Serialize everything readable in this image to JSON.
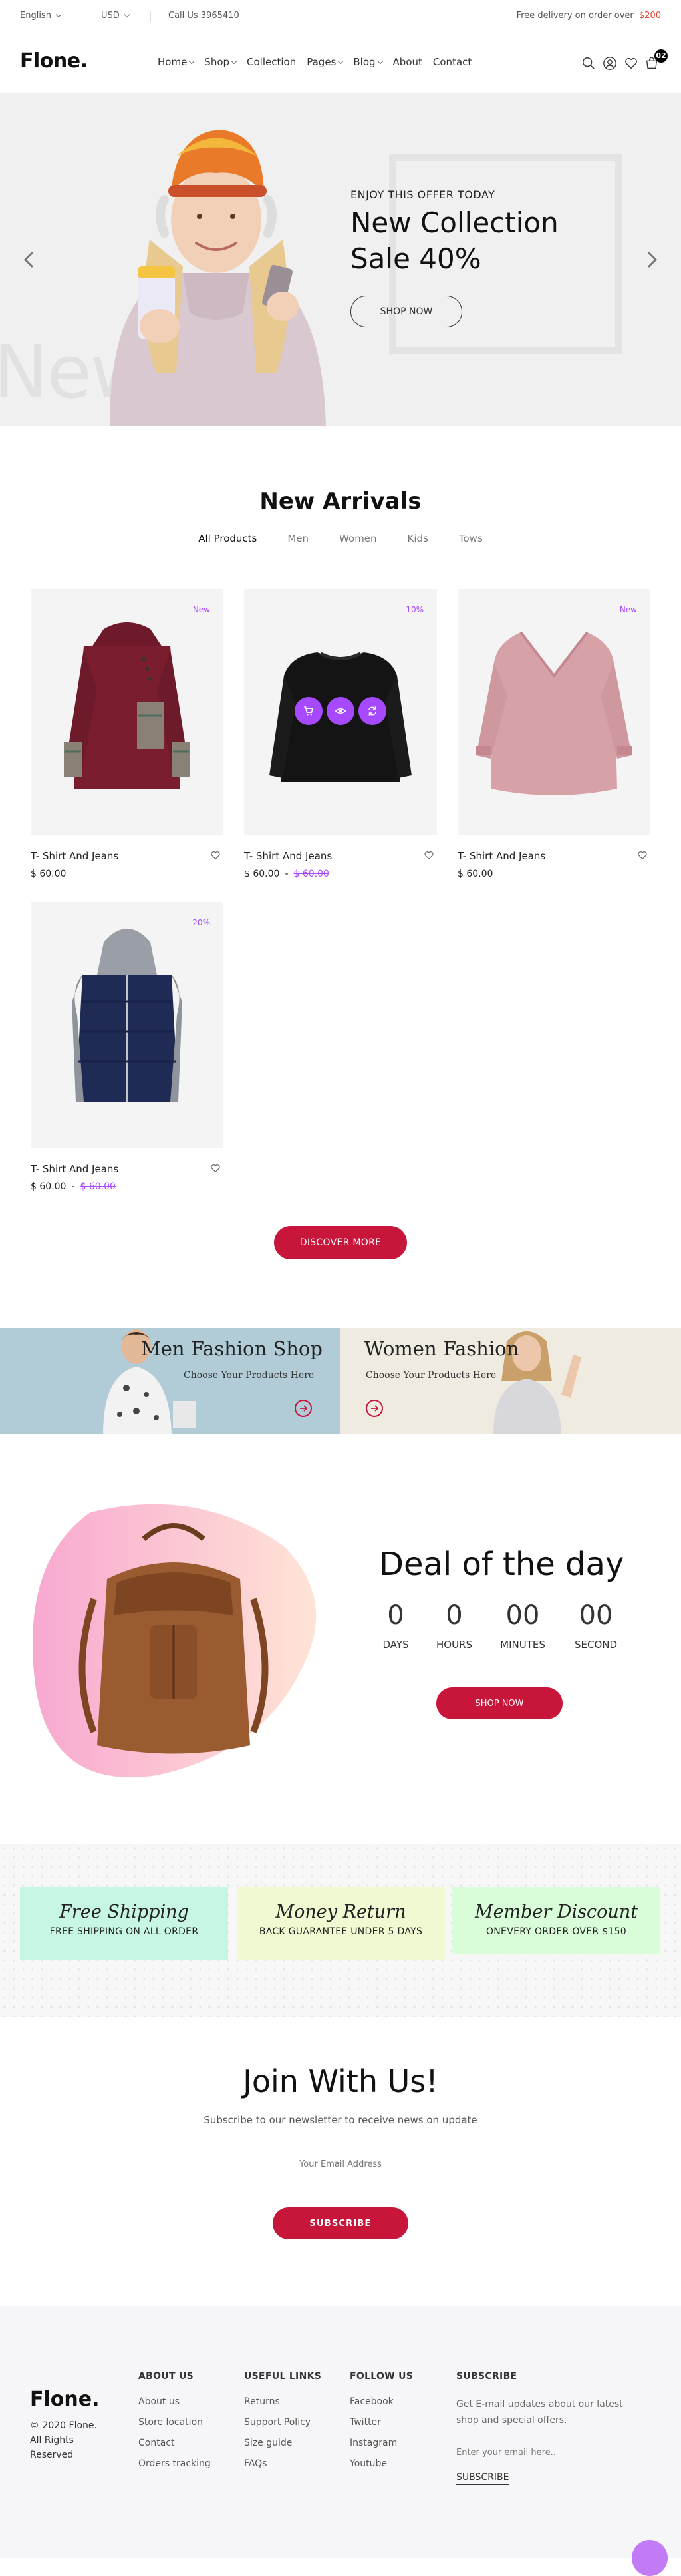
{
  "topbar": {
    "language": "English",
    "currency": "USD",
    "call": "Call Us 3965410",
    "delivery_text": "Free delivery on order over ",
    "delivery_amount": "$200"
  },
  "header": {
    "logo": "Flone.",
    "nav": [
      {
        "label": "Home",
        "has_dropdown": true
      },
      {
        "label": "Shop",
        "has_dropdown": true
      },
      {
        "label": "Collection",
        "has_dropdown": false
      },
      {
        "label": "Pages",
        "has_dropdown": true
      },
      {
        "label": "Blog",
        "has_dropdown": true
      },
      {
        "label": "About",
        "has_dropdown": false
      },
      {
        "label": "Contact",
        "has_dropdown": false
      }
    ],
    "icons": [
      "search-icon",
      "user-icon",
      "heart-icon",
      "cart-icon"
    ],
    "cart_count": "02"
  },
  "hero": {
    "eyebrow": "ENJOY THIS OFFER TODAY",
    "title_line1": "New Collection",
    "title_line2": "Sale 40%",
    "button": "SHOP NOW",
    "bg_text": "New Sale"
  },
  "new_arrivals": {
    "title": "New Arrivals",
    "tabs": [
      "All Products",
      "Men",
      "Women",
      "Kids",
      "Tows"
    ],
    "active_tab": "All Products",
    "products": [
      {
        "name": "T- Shirt And Jeans",
        "price": "$ 60.00",
        "old_price": "",
        "badge": "New"
      },
      {
        "name": "T- Shirt And Jeans",
        "price": "$ 60.00",
        "old_price": "$ 60.00",
        "badge": "-10%"
      },
      {
        "name": "T- Shirt And Jeans",
        "price": "$ 60.00",
        "old_price": "",
        "badge": "New"
      },
      {
        "name": "T- Shirt And Jeans",
        "price": "$ 60.00",
        "old_price": "$ 60.00",
        "badge": "-20%"
      }
    ],
    "price_separator": "-",
    "discover_button": "DISCOVER MORE"
  },
  "banners": [
    {
      "title": "Men Fashion Shop",
      "subtitle": "Choose Your Products Here"
    },
    {
      "title": "Women Fashion",
      "subtitle": "Choose Your Products Here"
    }
  ],
  "deal": {
    "title": "Deal of the day",
    "countdown": [
      {
        "value": "0",
        "label": "DAYS"
      },
      {
        "value": "0",
        "label": "HOURS"
      },
      {
        "value": "00",
        "label": "MINUTES"
      },
      {
        "value": "00",
        "label": "SECOND"
      }
    ],
    "button": "SHOP NOW"
  },
  "features": [
    {
      "title": "Free Shipping",
      "subtitle": "FREE SHIPPING ON ALL ORDER",
      "color": "#c8f6e4"
    },
    {
      "title": "Money Return",
      "subtitle": "BACK GUARANTEE UNDER 5 DAYS",
      "color": "#f1f9d2"
    },
    {
      "title": "Member Discount",
      "subtitle": "ONEVERY ORDER OVER $150",
      "color": "#d9fcd9"
    }
  ],
  "newsletter": {
    "title": "Join With Us!",
    "subtitle": "Subscribe to our newsletter to receive news on update",
    "placeholder": "Your Email Address",
    "button": "SUBSCRIBE"
  },
  "footer": {
    "logo": "Flone.",
    "copyright_line1": "© 2020 Flone.",
    "copyright_line2": "All Rights",
    "copyright_line3": "Reserved",
    "columns": [
      {
        "title": "ABOUT US",
        "links": [
          "About us",
          "Store location",
          "Contact",
          "Orders tracking"
        ]
      },
      {
        "title": "USEFUL LINKS",
        "links": [
          "Returns",
          "Support Policy",
          "Size guide",
          "FAQs"
        ]
      },
      {
        "title": "FOLLOW US",
        "links": [
          "Facebook",
          "Twitter",
          "Instagram",
          "Youtube"
        ]
      }
    ],
    "subscribe": {
      "title": "SUBSCRIBE",
      "text": "Get E-mail updates about our latest shop and special offers.",
      "placeholder": "Enter your email here..",
      "button": "SUBSCRIBE"
    }
  },
  "colors": {
    "accent": "#c8153a",
    "purple": "#a749ff",
    "footer_bg": "#f6f6f8",
    "hero_bg": "#f0f0f0"
  }
}
